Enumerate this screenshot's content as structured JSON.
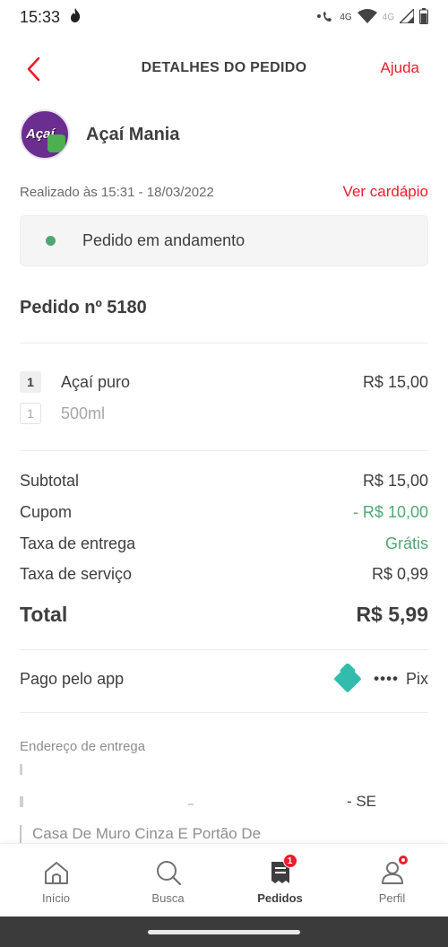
{
  "status_bar": {
    "time": "15:33",
    "network_left": "4G",
    "network_right": "4G"
  },
  "header": {
    "title": "DETALHES DO PEDIDO",
    "help_label": "Ajuda"
  },
  "store": {
    "logo_text": "Açaí",
    "name": "Açaí Mania"
  },
  "order": {
    "placed_at": "Realizado às 15:31 - 18/03/2022",
    "menu_link": "Ver cardápio",
    "status": "Pedido em andamento",
    "status_color": "#50a773",
    "number_label": "Pedido nº 5180"
  },
  "items": [
    {
      "qty": "1",
      "name": "Açaí puro",
      "price": "R$ 15,00"
    },
    {
      "qty": "1",
      "name": "500ml",
      "price": ""
    }
  ],
  "summary": {
    "subtotal_label": "Subtotal",
    "subtotal_value": "R$ 15,00",
    "coupon_label": "Cupom",
    "coupon_value": "- R$ 10,00",
    "delivery_label": "Taxa de entrega",
    "delivery_value": "Grátis",
    "service_label": "Taxa de serviço",
    "service_value": "R$ 0,99",
    "total_label": "Total",
    "total_value": "R$ 5,99"
  },
  "payment": {
    "label": "Pago pelo app",
    "icon": "pix-icon",
    "masked": "••••",
    "method": "Pix"
  },
  "address": {
    "title": "Endereço de entrega",
    "state": "- SE",
    "complement": "Casa De Muro Cinza E Portão De"
  },
  "bottom_nav": {
    "items": [
      {
        "label": "Início",
        "icon": "home-icon"
      },
      {
        "label": "Busca",
        "icon": "search-icon"
      },
      {
        "label": "Pedidos",
        "icon": "orders-icon",
        "badge": "1"
      },
      {
        "label": "Perfil",
        "icon": "profile-icon"
      }
    ]
  },
  "colors": {
    "accent": "#ea1d2c",
    "green": "#50a773",
    "pix": "#32bcad"
  }
}
